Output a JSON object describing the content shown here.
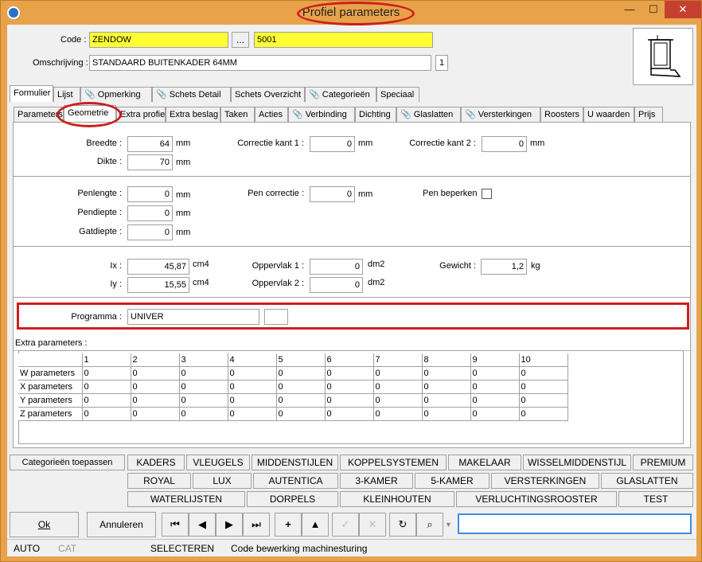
{
  "window": {
    "title": "Profiel parameters",
    "minimize": "—",
    "maximize": "☐",
    "close": "✕"
  },
  "header": {
    "code_label": "Code :",
    "code_value": "ZENDOW",
    "ellipsis": "...",
    "code_number": "5001",
    "desc_label": "Omschrijving :",
    "desc_value": "STANDAARD BUITENKADER 64MM",
    "desc_count": "1"
  },
  "main_tabs": [
    "Formulier",
    "Lijst",
    "Opmerking",
    "Schets Detail",
    "Schets Overzicht",
    "Categorieën",
    "Speciaal"
  ],
  "sub_tabs": [
    "Parameters",
    "Geometrie",
    "Extra profiel",
    "Extra beslag",
    "Taken",
    "Acties",
    "Verbinding",
    "Dichting",
    "Glaslatten",
    "Versterkingen",
    "Roosters",
    "U waarden",
    "Prijs"
  ],
  "geometry": {
    "breedte_label": "Breedte :",
    "breedte": "64",
    "breedte_unit": "mm",
    "dikte_label": "Dikte :",
    "dikte": "70",
    "dikte_unit": "mm",
    "ck1_label": "Correctie kant 1 :",
    "ck1": "0",
    "ck1_unit": "mm",
    "ck2_label": "Correctie kant 2 :",
    "ck2": "0",
    "ck2_unit": "mm",
    "penlengte_label": "Penlengte :",
    "penlengte": "0",
    "penlengte_unit": "mm",
    "pendiepte_label": "Pendiepte :",
    "pendiepte": "0",
    "pendiepte_unit": "mm",
    "gatdiepte_label": "Gatdiepte :",
    "gatdiepte": "0",
    "gatdiepte_unit": "mm",
    "pencor_label": "Pen correctie :",
    "pencor": "0",
    "pencor_unit": "mm",
    "penbep_label": "Pen beperken",
    "ix_label": "Ix :",
    "ix": "45,87",
    "ix_unit": "cm4",
    "iy_label": "Iy :",
    "iy": "15,55",
    "iy_unit": "cm4",
    "opp1_label": "Oppervlak 1 :",
    "opp1": "0",
    "opp1_unit": "dm2",
    "opp2_label": "Oppervlak 2 :",
    "opp2": "0",
    "opp2_unit": "dm2",
    "gewicht_label": "Gewicht :",
    "gewicht": "1,2",
    "gewicht_unit": "kg",
    "programma_label": "Programma :",
    "programma": "UNIVER"
  },
  "extra": {
    "title": "Extra parameters :",
    "columns": [
      "1",
      "2",
      "3",
      "4",
      "5",
      "6",
      "7",
      "8",
      "9",
      "10"
    ],
    "rows": [
      {
        "label": "W parameters",
        "values": [
          "0",
          "0",
          "0",
          "0",
          "0",
          "0",
          "0",
          "0",
          "0",
          "0"
        ]
      },
      {
        "label": "X parameters",
        "values": [
          "0",
          "0",
          "0",
          "0",
          "0",
          "0",
          "0",
          "0",
          "0",
          "0"
        ]
      },
      {
        "label": "Y parameters",
        "values": [
          "0",
          "0",
          "0",
          "0",
          "0",
          "0",
          "0",
          "0",
          "0",
          "0"
        ]
      },
      {
        "label": "Z parameters",
        "values": [
          "0",
          "0",
          "0",
          "0",
          "0",
          "0",
          "0",
          "0",
          "0",
          "0"
        ]
      }
    ]
  },
  "categories": {
    "apply": "Categorieën toepassen",
    "row1": [
      "KADERS",
      "VLEUGELS",
      "MIDDENSTIJLEN",
      "KOPPELSYSTEMEN",
      "MAKELAAR",
      "WISSELMIDDENSTIJL",
      "PREMIUM"
    ],
    "row2": [
      "ROYAL",
      "LUX",
      "AUTENTICA",
      "3-KAMER",
      "5-KAMER",
      "VERSTERKINGEN",
      "GLASLATTEN"
    ],
    "row3": [
      "WATERLIJSTEN",
      "DORPELS",
      "KLEINHOUTEN",
      "VERLUCHTINGSROOSTER",
      "TEST"
    ]
  },
  "footer": {
    "ok": "Ok",
    "cancel": "Annuleren",
    "search_value": ""
  },
  "status": {
    "auto": "AUTO",
    "cat": "CAT",
    "mode": "SELECTEREN",
    "message": "Code bewerking machinesturing"
  },
  "colors": {
    "title_bar": "#e8a24a",
    "highlight": "#ffff33",
    "annotation": "#cc1f1f"
  }
}
